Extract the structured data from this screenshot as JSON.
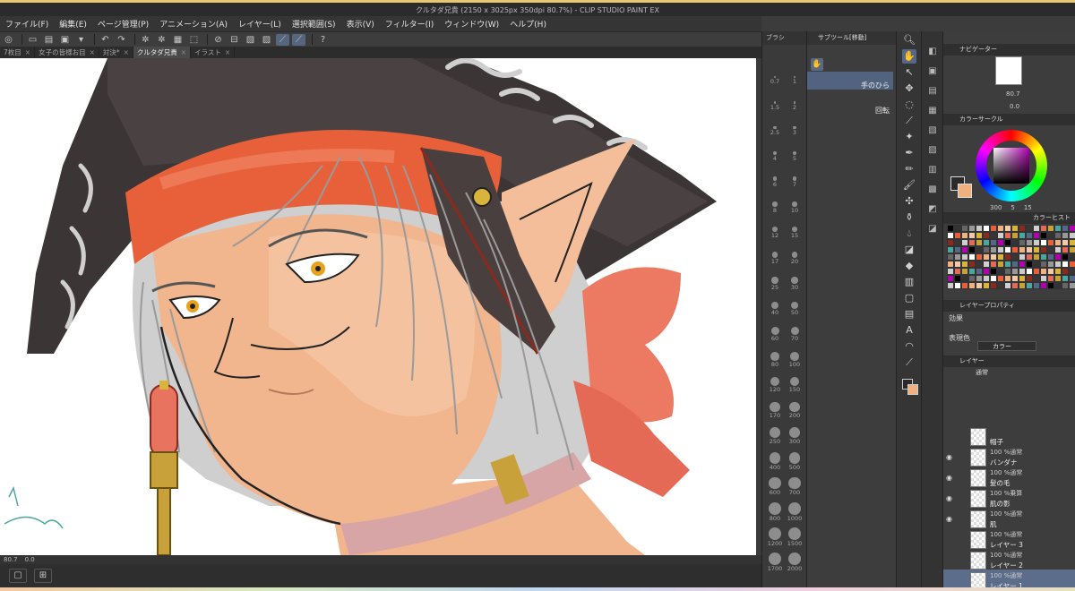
{
  "window": {
    "title": "クルタダ兄貴 (2150 x 3025px 350dpi 80.7%)  -  CLIP STUDIO PAINT EX"
  },
  "menu": [
    "ファイル(F)",
    "編集(E)",
    "ページ管理(P)",
    "アニメーション(A)",
    "レイヤー(L)",
    "選択範囲(S)",
    "表示(V)",
    "フィルター(I)",
    "ウィンドウ(W)",
    "ヘルプ(H)"
  ],
  "tabs": [
    {
      "label": "7枚目"
    },
    {
      "label": "女子の皆様お目"
    },
    {
      "label": "対決*"
    },
    {
      "label": "クルタダ兄貴",
      "active": true
    },
    {
      "label": "イラスト"
    }
  ],
  "status": {
    "zoom": "80.7",
    "zoom2": "0.0"
  },
  "brush_panel": {
    "title": "ブラシ",
    "sizes": [
      "0.7",
      "1",
      "1.5",
      "2",
      "2.5",
      "3",
      "4",
      "5",
      "6",
      "7",
      "8",
      "10",
      "12",
      "15",
      "17",
      "20",
      "25",
      "30",
      "40",
      "50",
      "60",
      "70",
      "80",
      "100",
      "120",
      "150",
      "170",
      "200",
      "250",
      "300",
      "400",
      "500",
      "600",
      "700",
      "800",
      "1000",
      "1200",
      "1500",
      "1700",
      "2000"
    ]
  },
  "subtool": {
    "title": "サブツール[移動]",
    "items": [
      {
        "label": "手のひら",
        "selected": true
      },
      {
        "label": "回転"
      }
    ]
  },
  "navigator": {
    "title": "ナビゲーター",
    "zoom": "80.7",
    "angle": "0.0"
  },
  "color_circle": {
    "title": "カラーサークル",
    "values": [
      "300",
      "5",
      "15"
    ]
  },
  "color_history": {
    "title": "カラーヒストリー"
  },
  "layer_property": {
    "title": "レイヤープロパティ",
    "effect_label": "効果",
    "expression_label": "表現色",
    "expression_value": "カラー"
  },
  "layer_panel": {
    "title": "レイヤー",
    "blend": "通常"
  },
  "layers": [
    {
      "mode": "",
      "name": "帽子"
    },
    {
      "mode": "100 %通常",
      "name": "バンダナ"
    },
    {
      "mode": "100 %通常",
      "name": "髪の毛"
    },
    {
      "mode": "100 %乗算",
      "name": "肌の影"
    },
    {
      "mode": "100 %通常",
      "name": "肌"
    },
    {
      "mode": "100 %通常",
      "name": "レイヤー 3"
    },
    {
      "mode": "100 %通常",
      "name": "レイヤー 2"
    },
    {
      "mode": "100 %通常",
      "name": "レイヤー 1",
      "selected": true
    },
    {
      "mode": "100 %通常",
      "name": ""
    }
  ],
  "colors": {
    "accent": "#56688a",
    "selected_layer": "#5b6d8a",
    "bandana": "#e8603a",
    "hat": "#3a3434",
    "hair": "#cfcfcf",
    "skin": "#f0b88e"
  }
}
